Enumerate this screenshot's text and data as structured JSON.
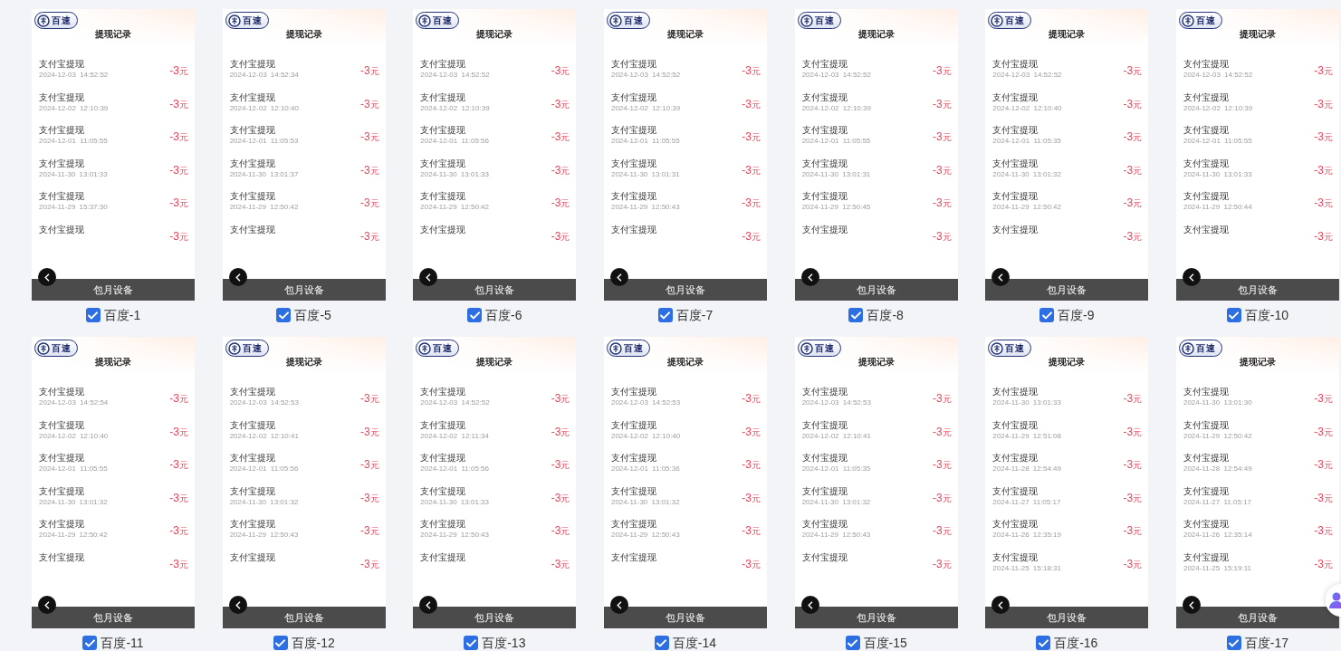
{
  "devices": [
    {
      "label": "百度-1",
      "checked": true,
      "screen": {
        "logo": "百速",
        "title": "提现记录",
        "bar": "包月设备",
        "records": [
          {
            "name": "支付宝提现",
            "time": "2024-12-03 14:52:52",
            "amount": "-3",
            "unit": "元"
          },
          {
            "name": "支付宝提现",
            "time": "2024-12-02 12:10:39",
            "amount": "-3",
            "unit": "元"
          },
          {
            "name": "支付宝提现",
            "time": "2024-12-01 11:05:55",
            "amount": "-3",
            "unit": "元"
          },
          {
            "name": "支付宝提现",
            "time": "2024-11-30 13:01:33",
            "amount": "-3",
            "unit": "元"
          },
          {
            "name": "支付宝提现",
            "time": "2024-11-29 15:37:30",
            "amount": "-3",
            "unit": "元"
          },
          {
            "name": "支付宝提现",
            "amount": "-3",
            "unit": "元"
          }
        ]
      }
    },
    {
      "label": "百度-5",
      "checked": true,
      "screen": {
        "logo": "百速",
        "title": "提现记录",
        "bar": "包月设备",
        "records": [
          {
            "name": "支付宝提现",
            "time": "2024-12-03 14:52:34",
            "amount": "-3",
            "unit": "元"
          },
          {
            "name": "支付宝提现",
            "time": "2024-12-02 12:10:40",
            "amount": "-3",
            "unit": "元"
          },
          {
            "name": "支付宝提现",
            "time": "2024-12-01 11:05:53",
            "amount": "-3",
            "unit": "元"
          },
          {
            "name": "支付宝提现",
            "time": "2024-11-30 13:01:37",
            "amount": "-3",
            "unit": "元"
          },
          {
            "name": "支付宝提现",
            "time": "2024-11-29 12:50:42",
            "amount": "-3",
            "unit": "元"
          },
          {
            "name": "支付宝提现",
            "amount": "-3",
            "unit": "元"
          }
        ]
      }
    },
    {
      "label": "百度-6",
      "checked": true,
      "screen": {
        "logo": "百速",
        "title": "提现记录",
        "bar": "包月设备",
        "records": [
          {
            "name": "支付宝提现",
            "time": "2024-12-03 14:52:52",
            "amount": "-3",
            "unit": "元"
          },
          {
            "name": "支付宝提现",
            "time": "2024-12-02 12:10:39",
            "amount": "-3",
            "unit": "元"
          },
          {
            "name": "支付宝提现",
            "time": "2024-12-01 11:05:56",
            "amount": "-3",
            "unit": "元"
          },
          {
            "name": "支付宝提现",
            "time": "2024-11-30 13:01:33",
            "amount": "-3",
            "unit": "元"
          },
          {
            "name": "支付宝提现",
            "time": "2024-11-29 12:50:42",
            "amount": "-3",
            "unit": "元"
          },
          {
            "name": "支付宝提现",
            "amount": "-3",
            "unit": "元"
          }
        ]
      }
    },
    {
      "label": "百度-7",
      "checked": true,
      "screen": {
        "logo": "百速",
        "title": "提现记录",
        "bar": "包月设备",
        "records": [
          {
            "name": "支付宝提现",
            "time": "2024-12-03 14:52:52",
            "amount": "-3",
            "unit": "元"
          },
          {
            "name": "支付宝提现",
            "time": "2024-12-02 12:10:39",
            "amount": "-3",
            "unit": "元"
          },
          {
            "name": "支付宝提现",
            "time": "2024-12-01 11:05:55",
            "amount": "-3",
            "unit": "元"
          },
          {
            "name": "支付宝提现",
            "time": "2024-11-30 13:01:31",
            "amount": "-3",
            "unit": "元"
          },
          {
            "name": "支付宝提现",
            "time": "2024-11-29 12:50:43",
            "amount": "-3",
            "unit": "元"
          },
          {
            "name": "支付宝提现",
            "amount": "-3",
            "unit": "元"
          }
        ]
      }
    },
    {
      "label": "百度-8",
      "checked": true,
      "screen": {
        "logo": "百速",
        "title": "提现记录",
        "bar": "包月设备",
        "records": [
          {
            "name": "支付宝提现",
            "time": "2024-12-03 14:52:52",
            "amount": "-3",
            "unit": "元"
          },
          {
            "name": "支付宝提现",
            "time": "2024-12-02 12:10:39",
            "amount": "-3",
            "unit": "元"
          },
          {
            "name": "支付宝提现",
            "time": "2024-12-01 11:05:55",
            "amount": "-3",
            "unit": "元"
          },
          {
            "name": "支付宝提现",
            "time": "2024-11-30 13:01:31",
            "amount": "-3",
            "unit": "元"
          },
          {
            "name": "支付宝提现",
            "time": "2024-11-29 12:50:45",
            "amount": "-3",
            "unit": "元"
          },
          {
            "name": "支付宝提现",
            "amount": "-3",
            "unit": "元"
          }
        ]
      }
    },
    {
      "label": "百度-9",
      "checked": true,
      "screen": {
        "logo": "百速",
        "title": "提现记录",
        "bar": "包月设备",
        "records": [
          {
            "name": "支付宝提现",
            "time": "2024-12-03 14:52:52",
            "amount": "-3",
            "unit": "元"
          },
          {
            "name": "支付宝提现",
            "time": "2024-12-02 12:10:40",
            "amount": "-3",
            "unit": "元"
          },
          {
            "name": "支付宝提现",
            "time": "2024-12-01 11:05:35",
            "amount": "-3",
            "unit": "元"
          },
          {
            "name": "支付宝提现",
            "time": "2024-11-30 13:01:32",
            "amount": "-3",
            "unit": "元"
          },
          {
            "name": "支付宝提现",
            "time": "2024-11-29 12:50:42",
            "amount": "-3",
            "unit": "元"
          },
          {
            "name": "支付宝提现",
            "amount": "-3",
            "unit": "元"
          }
        ]
      }
    },
    {
      "label": "百度-10",
      "checked": true,
      "screen": {
        "logo": "百速",
        "title": "提现记录",
        "bar": "包月设备",
        "records": [
          {
            "name": "支付宝提现",
            "time": "2024-12-03 14:52:52",
            "amount": "-3",
            "unit": "元"
          },
          {
            "name": "支付宝提现",
            "time": "2024-12-02 12:10:39",
            "amount": "-3",
            "unit": "元"
          },
          {
            "name": "支付宝提现",
            "time": "2024-12-01 11:05:55",
            "amount": "-3",
            "unit": "元"
          },
          {
            "name": "支付宝提现",
            "time": "2024-11-30 13:01:33",
            "amount": "-3",
            "unit": "元"
          },
          {
            "name": "支付宝提现",
            "time": "2024-11-29 12:50:44",
            "amount": "-3",
            "unit": "元"
          },
          {
            "name": "支付宝提现",
            "amount": "-3",
            "unit": "元"
          }
        ]
      }
    },
    {
      "label": "百度-11",
      "checked": true,
      "screen": {
        "logo": "百速",
        "title": "提现记录",
        "bar": "包月设备",
        "records": [
          {
            "name": "支付宝提现",
            "time": "2024-12-03 14:52:54",
            "amount": "-3",
            "unit": "元"
          },
          {
            "name": "支付宝提现",
            "time": "2024-12-02 12:10:40",
            "amount": "-3",
            "unit": "元"
          },
          {
            "name": "支付宝提现",
            "time": "2024-12-01 11:05:55",
            "amount": "-3",
            "unit": "元"
          },
          {
            "name": "支付宝提现",
            "time": "2024-11-30 13:01:32",
            "amount": "-3",
            "unit": "元"
          },
          {
            "name": "支付宝提现",
            "time": "2024-11-29 12:50:42",
            "amount": "-3",
            "unit": "元"
          },
          {
            "name": "支付宝提现",
            "amount": "-3",
            "unit": "元"
          }
        ]
      }
    },
    {
      "label": "百度-12",
      "checked": true,
      "screen": {
        "logo": "百速",
        "title": "提现记录",
        "bar": "包月设备",
        "records": [
          {
            "name": "支付宝提现",
            "time": "2024-12-03 14:52:53",
            "amount": "-3",
            "unit": "元"
          },
          {
            "name": "支付宝提现",
            "time": "2024-12-02 12:10:41",
            "amount": "-3",
            "unit": "元"
          },
          {
            "name": "支付宝提现",
            "time": "2024-12-01 11:05:56",
            "amount": "-3",
            "unit": "元"
          },
          {
            "name": "支付宝提现",
            "time": "2024-11-30 13:01:32",
            "amount": "-3",
            "unit": "元"
          },
          {
            "name": "支付宝提现",
            "time": "2024-11-29 12:50:43",
            "amount": "-3",
            "unit": "元"
          },
          {
            "name": "支付宝提现",
            "amount": "-3",
            "unit": "元"
          }
        ]
      }
    },
    {
      "label": "百度-13",
      "checked": true,
      "screen": {
        "logo": "百速",
        "title": "提现记录",
        "bar": "包月设备",
        "records": [
          {
            "name": "支付宝提现",
            "time": "2024-12-03 14:52:52",
            "amount": "-3",
            "unit": "元"
          },
          {
            "name": "支付宝提现",
            "time": "2024-12-02 12:11:34",
            "amount": "-3",
            "unit": "元"
          },
          {
            "name": "支付宝提现",
            "time": "2024-12-01 11:05:56",
            "amount": "-3",
            "unit": "元"
          },
          {
            "name": "支付宝提现",
            "time": "2024-11-30 13:01:33",
            "amount": "-3",
            "unit": "元"
          },
          {
            "name": "支付宝提现",
            "time": "2024-11-29 12:50:43",
            "amount": "-3",
            "unit": "元"
          },
          {
            "name": "支付宝提现",
            "amount": "-3",
            "unit": "元"
          }
        ]
      }
    },
    {
      "label": "百度-14",
      "checked": true,
      "screen": {
        "logo": "百速",
        "title": "提现记录",
        "bar": "包月设备",
        "records": [
          {
            "name": "支付宝提现",
            "time": "2024-12-03 14:52:53",
            "amount": "-3",
            "unit": "元"
          },
          {
            "name": "支付宝提现",
            "time": "2024-12-02 12:10:40",
            "amount": "-3",
            "unit": "元"
          },
          {
            "name": "支付宝提现",
            "time": "2024-12-01 11:05:36",
            "amount": "-3",
            "unit": "元"
          },
          {
            "name": "支付宝提现",
            "time": "2024-11-30 13:01:32",
            "amount": "-3",
            "unit": "元"
          },
          {
            "name": "支付宝提现",
            "time": "2024-11-29 12:50:43",
            "amount": "-3",
            "unit": "元"
          },
          {
            "name": "支付宝提现",
            "amount": "-3",
            "unit": "元"
          }
        ]
      }
    },
    {
      "label": "百度-15",
      "checked": true,
      "screen": {
        "logo": "百速",
        "title": "提现记录",
        "bar": "包月设备",
        "records": [
          {
            "name": "支付宝提现",
            "time": "2024-12-03 14:52:53",
            "amount": "-3",
            "unit": "元"
          },
          {
            "name": "支付宝提现",
            "time": "2024-12-02 12:10:41",
            "amount": "-3",
            "unit": "元"
          },
          {
            "name": "支付宝提现",
            "time": "2024-12-01 11:05:35",
            "amount": "-3",
            "unit": "元"
          },
          {
            "name": "支付宝提现",
            "time": "2024-11-30 13:01:32",
            "amount": "-3",
            "unit": "元"
          },
          {
            "name": "支付宝提现",
            "time": "2024-11-29 12:50:43",
            "amount": "-3",
            "unit": "元"
          },
          {
            "name": "支付宝提现",
            "amount": "-3",
            "unit": "元"
          }
        ]
      }
    },
    {
      "label": "百度-16",
      "checked": true,
      "screen": {
        "logo": "百速",
        "title": "提现记录",
        "bar": "包月设备",
        "records": [
          {
            "name": "支付宝提现",
            "time": "2024-11-30 13:01:33",
            "amount": "-3",
            "unit": "元"
          },
          {
            "name": "支付宝提现",
            "time": "2024-11-29 12:51:08",
            "amount": "-3",
            "unit": "元"
          },
          {
            "name": "支付宝提现",
            "time": "2024-11-28 12:54:49",
            "amount": "-3",
            "unit": "元"
          },
          {
            "name": "支付宝提现",
            "time": "2024-11-27 11:05:17",
            "amount": "-3",
            "unit": "元"
          },
          {
            "name": "支付宝提现",
            "time": "2024-11-26 12:35:19",
            "amount": "-3",
            "unit": "元"
          },
          {
            "name": "支付宝提现",
            "time": "2024-11-25 15:18:31",
            "amount": "-3",
            "unit": "元"
          }
        ]
      }
    },
    {
      "label": "百度-17",
      "checked": true,
      "screen": {
        "logo": "百速",
        "title": "提现记录",
        "bar": "包月设备",
        "records": [
          {
            "name": "支付宝提现",
            "time": "2024-11-30 13:01:30",
            "amount": "-3",
            "unit": "元"
          },
          {
            "name": "支付宝提现",
            "time": "2024-11-29 12:50:42",
            "amount": "-3",
            "unit": "元"
          },
          {
            "name": "支付宝提现",
            "time": "2024-11-28 12:54:49",
            "amount": "-3",
            "unit": "元"
          },
          {
            "name": "支付宝提现",
            "time": "2024-11-27 11:05:17",
            "amount": "-3",
            "unit": "元"
          },
          {
            "name": "支付宝提现",
            "time": "2024-11-26 12:35:14",
            "amount": "-3",
            "unit": "元"
          },
          {
            "name": "支付宝提现",
            "time": "2024-11-25 15:19:11",
            "amount": "-3",
            "unit": "元"
          }
        ]
      }
    }
  ]
}
